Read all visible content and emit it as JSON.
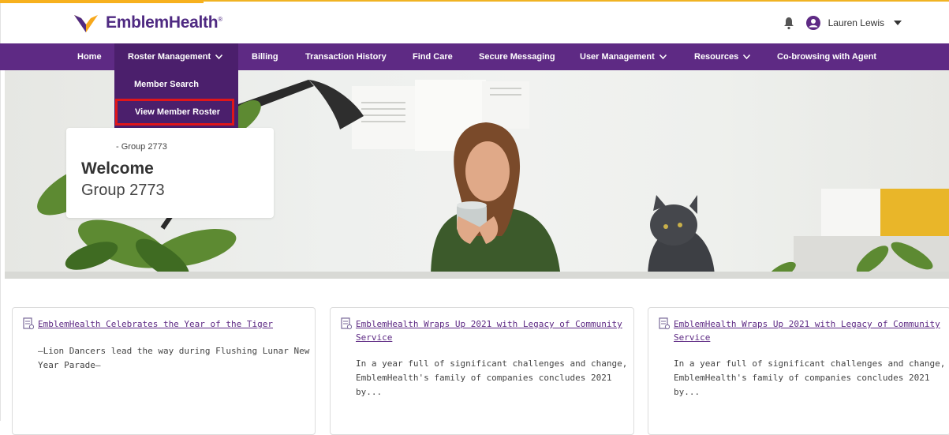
{
  "header": {
    "brand": "EmblemHealth",
    "brand_mark": "®",
    "user_name": "Lauren Lewis"
  },
  "nav": {
    "items": [
      {
        "label": "Home"
      },
      {
        "label": "Roster Management"
      },
      {
        "label": "Billing"
      },
      {
        "label": "Transaction History"
      },
      {
        "label": "Find Care"
      },
      {
        "label": "Secure Messaging"
      },
      {
        "label": "User Management"
      },
      {
        "label": "Resources"
      },
      {
        "label": "Co-browsing with Agent"
      }
    ],
    "dropdown": {
      "items": [
        {
          "label": "Member Search"
        },
        {
          "label": "View Member Roster"
        }
      ]
    }
  },
  "welcome": {
    "subtitle": "- Group 2773",
    "title": "Welcome",
    "group": "Group 2773"
  },
  "news": [
    {
      "title_line1": "EmblemHealth Celebrates the Year of the Tiger",
      "title_line2": "",
      "body_line1": "—Lion Dancers lead the way during Flushing Lunar New",
      "body_line2": "Year Parade—"
    },
    {
      "title_line1": "EmblemHealth Wraps Up 2021 with Legacy of Community",
      "title_line2": "Service",
      "body_line1": "In a year full of significant challenges and change,",
      "body_line2": "EmblemHealth's family of companies concludes 2021 by..."
    },
    {
      "title_line1": "EmblemHealth Wraps Up 2021 with Legacy of Community",
      "title_line2": "Service",
      "body_line1": "In a year full of significant challenges and change,",
      "body_line2": "EmblemHealth's family of companies concludes 2021 by..."
    }
  ],
  "colors": {
    "brand_purple": "#5e2a84",
    "nav_active": "#4b1f6c",
    "highlight_red": "#e0161a",
    "accent_yellow": "#f0b323"
  },
  "icons": [
    "bell-icon",
    "user-avatar-icon",
    "caret-down-icon",
    "chevron-down-icon",
    "article-icon"
  ]
}
